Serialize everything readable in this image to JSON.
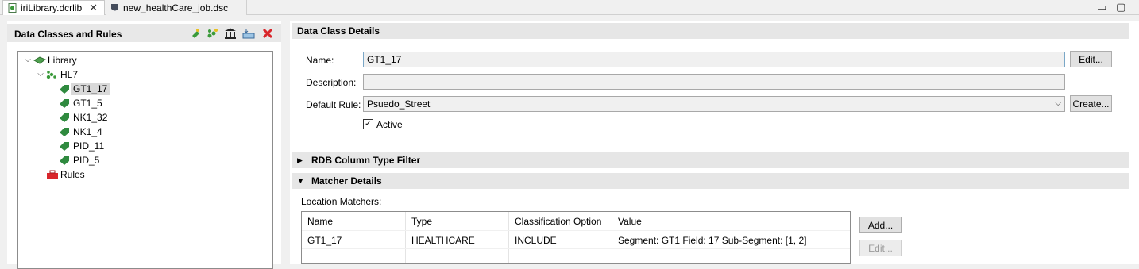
{
  "tabs": [
    {
      "label": "iriLibrary.dcrlib",
      "active": true
    },
    {
      "label": "new_healthCare_job.dsc",
      "active": false
    }
  ],
  "window_controls": {
    "minimize": "▭",
    "maximize": "▢"
  },
  "left_panel": {
    "title": "Data Classes and Rules",
    "toolbar_icons": [
      "add-class-icon",
      "add-group-icon",
      "library-icon",
      "import-icon",
      "delete-icon"
    ],
    "tree": {
      "root": "Library",
      "group": "HL7",
      "items": [
        "GT1_17",
        "GT1_5",
        "NK1_32",
        "NK1_4",
        "PID_11",
        "PID_5"
      ],
      "rules": "Rules"
    }
  },
  "details": {
    "section_title": "Data Class Details",
    "name_label": "Name:",
    "name_value": "GT1_17",
    "description_label": "Description:",
    "description_value": "",
    "default_rule_label": "Default Rule:",
    "default_rule_value": "Psuedo_Street",
    "active_label": "Active",
    "active_checked": true,
    "edit_button": "Edit...",
    "create_button": "Create..."
  },
  "rdb_section": {
    "title": "RDB Column Type Filter",
    "expanded": false
  },
  "matcher_section": {
    "title": "Matcher Details",
    "expanded": true,
    "location_label": "Location Matchers:",
    "columns": [
      "Name",
      "Type",
      "Classification Option",
      "Value"
    ],
    "rows": [
      [
        "GT1_17",
        "HEALTHCARE",
        "INCLUDE",
        "Segment: GT1 Field: 17 Sub-Segment: [1, 2]"
      ]
    ],
    "add_button": "Add...",
    "edit_button": "Edit..."
  },
  "colors": {
    "accent_green": "#3a9a3a",
    "selected_bg": "#d9d9d9",
    "section_bg": "#e6e6e6",
    "delete_red": "#d9262b"
  }
}
